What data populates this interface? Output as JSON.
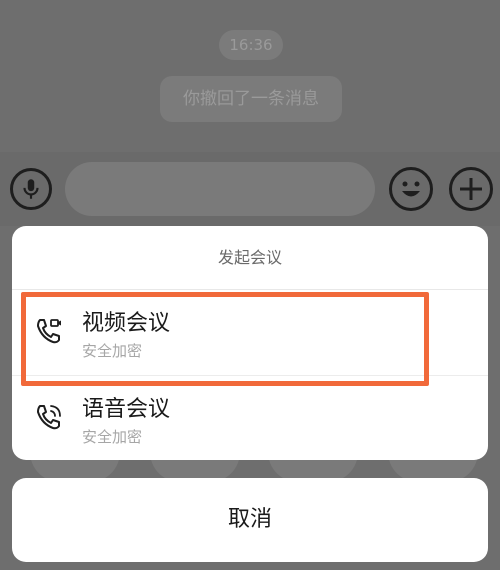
{
  "chat": {
    "time": "16:36",
    "recall_notice": "你撤回了一条消息"
  },
  "sheet": {
    "title": "发起会议",
    "options": [
      {
        "label": "视频会议",
        "sub": "安全加密",
        "icon": "video-call-icon"
      },
      {
        "label": "语音会议",
        "sub": "安全加密",
        "icon": "voice-call-icon"
      }
    ],
    "cancel_label": "取消"
  },
  "colors": {
    "highlight": "#f1693a",
    "overlay": "#6e6e6e",
    "sheet_bg": "#ffffff"
  }
}
